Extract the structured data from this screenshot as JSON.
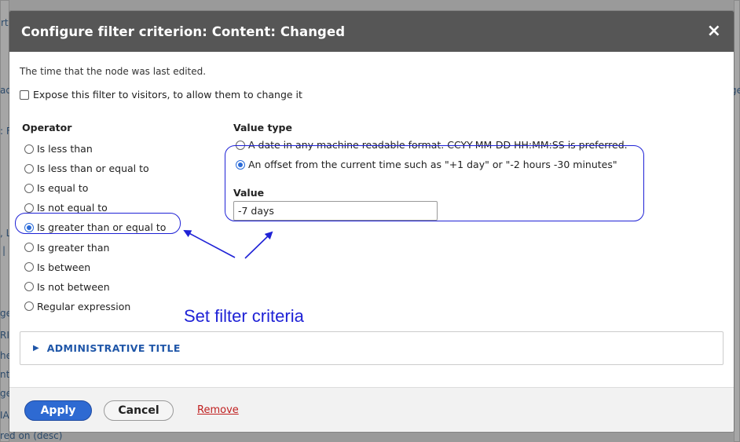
{
  "background": {
    "fragments": [
      "rt",
      "ad",
      ": F",
      ", L",
      "|",
      "ge",
      "RI",
      "he",
      "nt",
      "ge",
      "IA",
      "red on (desc)",
      "ge/"
    ]
  },
  "dialog": {
    "title": "Configure filter criterion: Content: Changed",
    "close_icon": "×",
    "description": "The time that the node was last edited.",
    "expose_label": "Expose this filter to visitors, to allow them to change it",
    "operator": {
      "title": "Operator",
      "options": [
        {
          "label": "Is less than",
          "checked": false
        },
        {
          "label": "Is less than or equal to",
          "checked": false
        },
        {
          "label": "Is equal to",
          "checked": false
        },
        {
          "label": "Is not equal to",
          "checked": false
        },
        {
          "label": "Is greater than or equal to",
          "checked": true
        },
        {
          "label": "Is greater than",
          "checked": false
        },
        {
          "label": "Is between",
          "checked": false
        },
        {
          "label": "Is not between",
          "checked": false
        },
        {
          "label": "Regular expression",
          "checked": false
        }
      ]
    },
    "value_type": {
      "title": "Value type",
      "options": [
        {
          "label": "A date in any machine readable format. CCYY-MM-DD HH:MM:SS is preferred.",
          "checked": false
        },
        {
          "label": "An offset from the current time such as \"+1 day\" or \"-2 hours -30 minutes\"",
          "checked": true
        }
      ]
    },
    "value": {
      "title": "Value",
      "input_value": "-7 days"
    },
    "annotation": {
      "text": "Set filter criteria",
      "color": "#1f22d6"
    },
    "admin_title": {
      "icon": "▶",
      "label": "ADMINISTRATIVE TITLE"
    },
    "footer": {
      "apply_label": "Apply",
      "cancel_label": "Cancel",
      "remove_label": "Remove"
    }
  },
  "colors": {
    "titlebar": "#565656",
    "primary_button": "#2e6ad2",
    "link": "#1f56a8",
    "remove": "#c02020"
  }
}
